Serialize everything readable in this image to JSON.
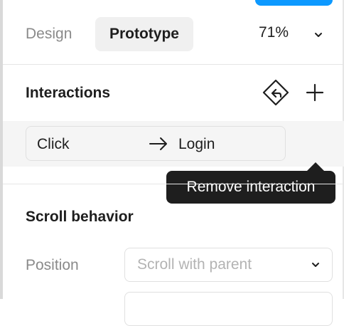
{
  "tabs": [
    {
      "label": "Design",
      "active": false
    },
    {
      "label": "Prototype",
      "active": true
    }
  ],
  "zoom": {
    "value": "71%",
    "icon": "chevron-down-icon"
  },
  "interactions": {
    "title": "Interactions",
    "icons": [
      "undo-interaction-icon",
      "plus-icon"
    ],
    "items": [
      {
        "trigger": "Click",
        "action_icon": "arrow-right-icon",
        "destination": "Login"
      }
    ],
    "tooltip": "Remove interaction"
  },
  "scroll": {
    "title": "Scroll behavior",
    "position_label": "Position",
    "position_value": "Scroll with parent"
  },
  "colors": {
    "accent": "#0d99ff",
    "tooltip_bg": "#1e1e1e",
    "active_tab_bg": "#f0f0f0",
    "row_bg": "#f5f5f5"
  }
}
